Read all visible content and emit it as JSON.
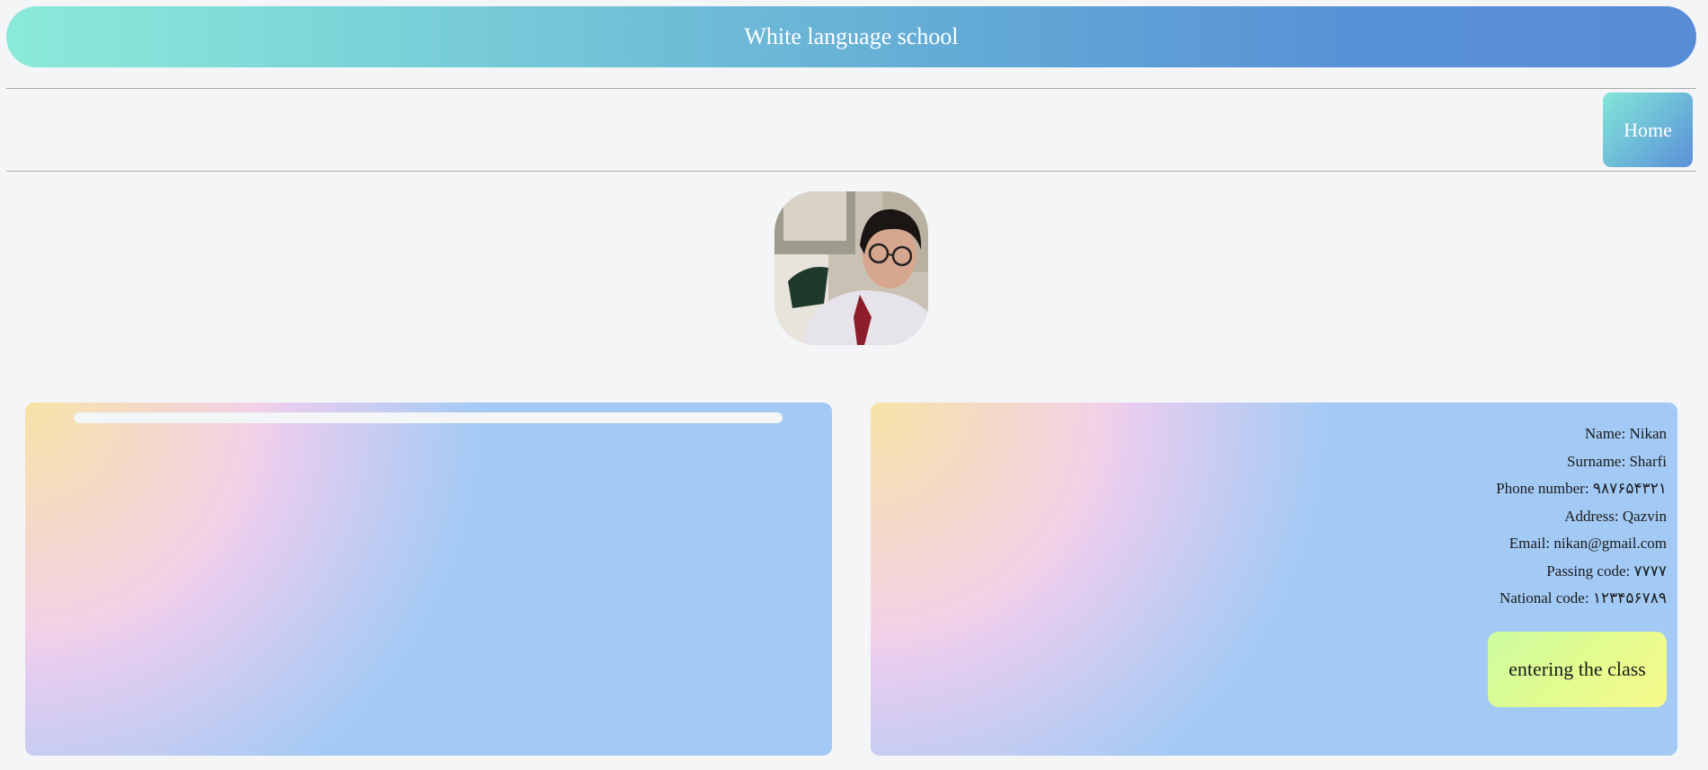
{
  "header": {
    "title": "White language school"
  },
  "nav": {
    "home_label": "Home"
  },
  "profile": {
    "avatar_icon": "student-photo",
    "fields": [
      {
        "label": "Name:",
        "value": "Nikan"
      },
      {
        "label": "Surname:",
        "value": "Sharfi"
      },
      {
        "label": "Phone number:",
        "value": "۹۸۷۶۵۴۳۲۱"
      },
      {
        "label": "Address:",
        "value": "Qazvin"
      },
      {
        "label": "Email:",
        "value": "nikan@gmail.com"
      },
      {
        "label": "Passing code:",
        "value": "۷۷۷۷"
      },
      {
        "label": "National code:",
        "value": "۱۲۳۴۵۶۷۸۹"
      }
    ],
    "enter_button_label": "entering the class"
  },
  "colors": {
    "header_start": "#8aead8",
    "header_end": "#578cd7",
    "card_base": "#a3caf5",
    "enter_button": "#e2fc8f"
  }
}
